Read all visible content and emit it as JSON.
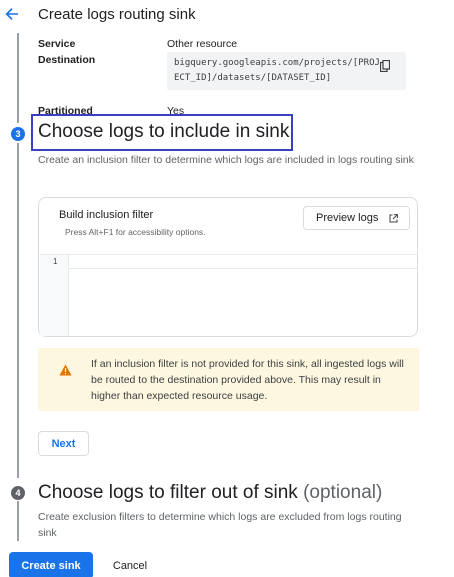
{
  "header": {
    "back_icon": "arrow-back-icon",
    "title": "Create logs routing sink"
  },
  "destination": {
    "service_label": "Service",
    "service_value": "Other resource",
    "destination_label": "Destination",
    "destination_value": "bigquery.googleapis.com/projects/[PROJECT_ID]/datasets/[DATASET_ID]",
    "copy_icon": "copy-icon"
  },
  "partitioned": {
    "label": "Partitioned",
    "value": "Yes"
  },
  "step3": {
    "number": "3",
    "title": "Choose logs to include in sink",
    "description": "Create an inclusion filter to determine which logs are included in logs routing sink",
    "filter": {
      "title": "Build inclusion filter",
      "hint": "Press Alt+F1 for accessibility options.",
      "preview_label": "Preview logs",
      "preview_icon": "open-in-new-icon",
      "line_number": "1",
      "query": ""
    },
    "warning": {
      "icon": "warning-icon",
      "text": "If an inclusion filter is not provided for this sink, all ingested logs will be routed to the destination provided above. This may result in higher than expected resource usage."
    },
    "next_label": "Next"
  },
  "step4": {
    "number": "4",
    "title": "Choose logs to filter out of sink",
    "optional": "(optional)",
    "description": "Create exclusion filters to determine which logs are excluded from logs routing sink"
  },
  "footer": {
    "create_label": "Create sink",
    "cancel_label": "Cancel"
  },
  "colors": {
    "accent": "#1a73e8",
    "highlight_border": "#3b3fc4",
    "warning_bg": "#fef7e0",
    "warning_icon": "#e37400"
  }
}
